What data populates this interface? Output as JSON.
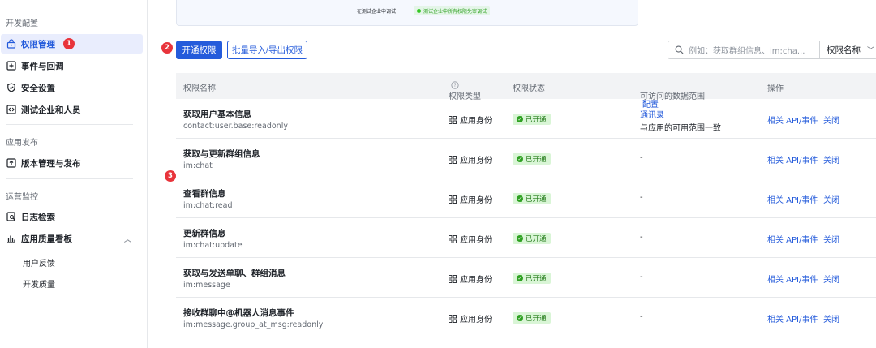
{
  "sidebar": {
    "sections": [
      {
        "title": "开发配置"
      },
      {
        "title": "应用发布"
      },
      {
        "title": "运营监控"
      }
    ],
    "items": [
      {
        "label": "权限管理",
        "icon": "lock-icon",
        "badge": "1"
      },
      {
        "label": "事件与回调",
        "icon": "plus-square-icon"
      },
      {
        "label": "安全设置",
        "icon": "shield-icon"
      },
      {
        "label": "测试企业和人员",
        "icon": "code-icon"
      },
      {
        "label": "版本管理与发布",
        "icon": "upload-icon"
      },
      {
        "label": "日志检索",
        "icon": "log-search-icon"
      },
      {
        "label": "应用质量看板",
        "icon": "bar-chart-icon"
      }
    ],
    "subitems": [
      {
        "label": "用户反馈"
      },
      {
        "label": "开发质量"
      }
    ]
  },
  "preview": {
    "step1": "在测试企业中调试",
    "step2": "测试企业中所有权限免审调试"
  },
  "toolbar": {
    "enable_label": "开通权限",
    "bulk_label": "批量导入/导出权限",
    "search_placeholder": "例如：获取群组信息、im:cha...",
    "filter_label": "权限名称"
  },
  "annotations": {
    "a1": "1",
    "a2": "2",
    "a3": "3"
  },
  "table": {
    "headers": {
      "name": "权限名称",
      "type": "权限类型",
      "status": "权限状态",
      "scope": "可访问的数据范围",
      "scope_config": "配置",
      "actions": "操作"
    },
    "rows": [
      {
        "name": "获取用户基本信息",
        "code": "contact:user.base:readonly",
        "type": "应用身份",
        "status": "已开通",
        "scope_link": "通讯录",
        "scope_desc": "与应用的可用范围一致",
        "act1": "相关 API/事件",
        "act2": "关闭"
      },
      {
        "name": "获取与更新群组信息",
        "code": "im:chat",
        "type": "应用身份",
        "status": "已开通",
        "scope": "-",
        "act1": "相关 API/事件",
        "act2": "关闭"
      },
      {
        "name": "查看群信息",
        "code": "im:chat:read",
        "type": "应用身份",
        "status": "已开通",
        "scope": "-",
        "act1": "相关 API/事件",
        "act2": "关闭"
      },
      {
        "name": "更新群信息",
        "code": "im:chat:update",
        "type": "应用身份",
        "status": "已开通",
        "scope": "-",
        "act1": "相关 API/事件",
        "act2": "关闭"
      },
      {
        "name": "获取与发送单聊、群组消息",
        "code": "im:message",
        "type": "应用身份",
        "status": "已开通",
        "scope": "-",
        "act1": "相关 API/事件",
        "act2": "关闭"
      },
      {
        "name": "接收群聊中@机器人消息事件",
        "code": "im:message.group_at_msg:readonly",
        "type": "应用身份",
        "status": "已开通",
        "scope": "-",
        "act1": "相关 API/事件",
        "act2": "关闭"
      }
    ]
  },
  "colors": {
    "accent": "#245bdb",
    "badge": "#e8343b",
    "success": "#2ea121"
  }
}
